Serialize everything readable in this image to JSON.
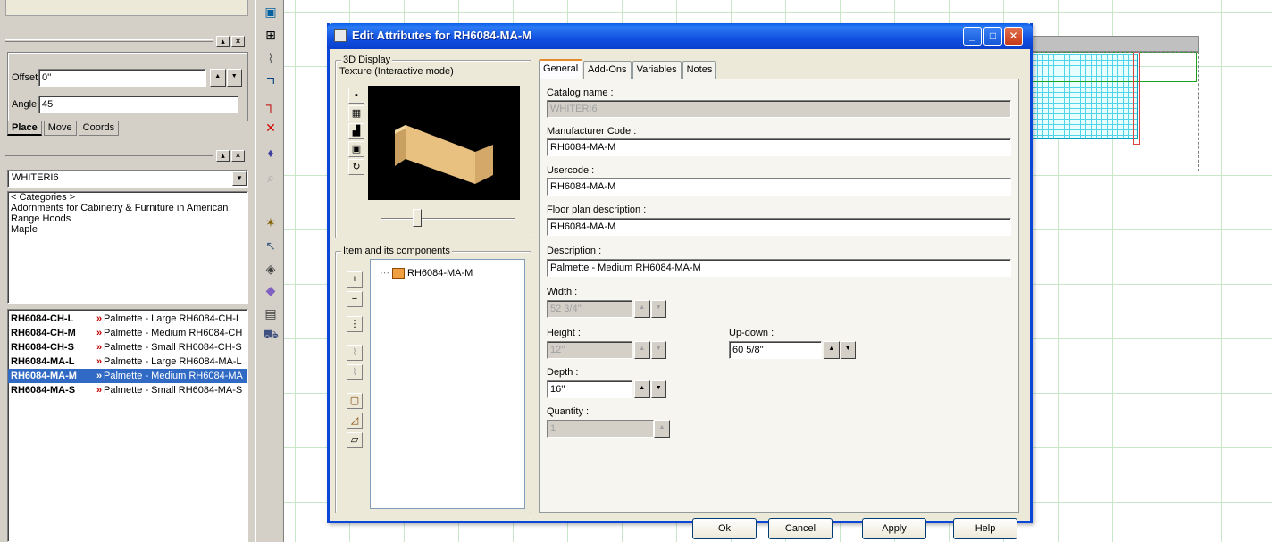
{
  "left_panel": {
    "offset_label": "Offset",
    "offset_value": "0''",
    "angle_label": "Angle",
    "angle_value": "45",
    "tabs": [
      "Place",
      "Move",
      "Coords"
    ],
    "catalog_value": "WHITERI6",
    "categories": [
      "< Categories >",
      "Adornments for Cabinetry & Furniture in American",
      "Range Hoods",
      "Maple"
    ],
    "products": [
      {
        "code": "RH6084-CH-L",
        "desc": "Palmette - Large RH6084-CH-L"
      },
      {
        "code": "RH6084-CH-M",
        "desc": "Palmette - Medium RH6084-CH"
      },
      {
        "code": "RH6084-CH-S",
        "desc": "Palmette - Small RH6084-CH-S"
      },
      {
        "code": "RH6084-MA-L",
        "desc": "Palmette - Large RH6084-MA-L"
      },
      {
        "code": "RH6084-MA-M",
        "desc": "Palmette - Medium RH6084-MA"
      },
      {
        "code": "RH6084-MA-S",
        "desc": "Palmette - Small RH6084-MA-S"
      }
    ],
    "selected_product": "RH6084-MA-M"
  },
  "dialog": {
    "title": "Edit Attributes for RH6084-MA-M",
    "display_group": "3D Display",
    "display_mode": "Texture (Interactive mode)",
    "components_group": "Item and its components",
    "tree_item": "RH6084-MA-M",
    "tabs": [
      "General",
      "Add-Ons",
      "Variables",
      "Notes"
    ],
    "active_tab": "General",
    "catalog_name_label": "Catalog name :",
    "catalog_name": "WHITERI6",
    "manufacturer_code_label": "Manufacturer Code :",
    "manufacturer_code": "RH6084-MA-M",
    "usercode_label": "Usercode :",
    "usercode": "RH6084-MA-M",
    "floor_plan_label": "Floor plan description :",
    "floor_plan": "RH6084-MA-M",
    "description_label": "Description :",
    "description": "Palmette - Medium RH6084-MA-M",
    "width_label": "Width :",
    "width": "52 3/4''",
    "height_label": "Height :",
    "height": "12''",
    "updown_label": "Up-down :",
    "updown": "60 5/8''",
    "depth_label": "Depth :",
    "depth": "16''",
    "quantity_label": "Quantity :",
    "quantity": "1",
    "buttons": {
      "ok": "Ok",
      "cancel": "Cancel",
      "apply": "Apply",
      "help": "Help"
    }
  },
  "colors": {
    "titlebar": "#0a5fe8",
    "selection": "#316ac5",
    "grid": "#c8e6c8",
    "accent_tab": "#e68b2c"
  }
}
